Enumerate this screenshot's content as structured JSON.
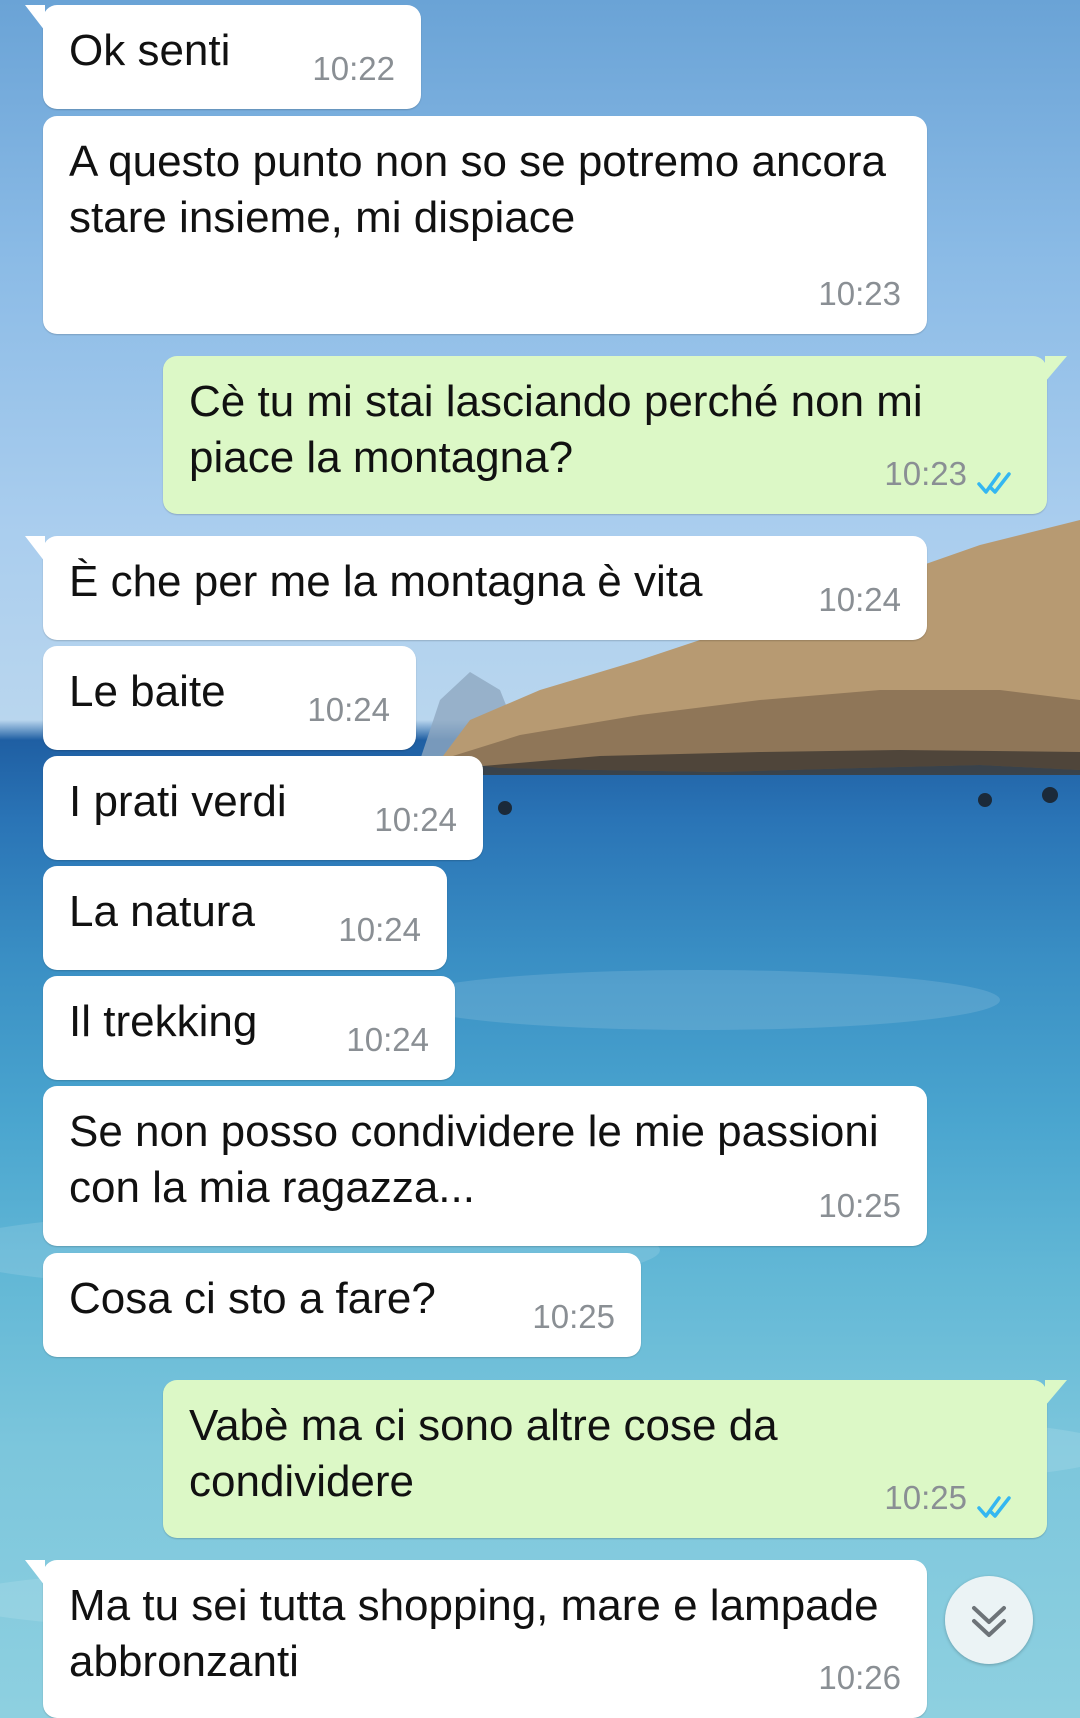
{
  "colors": {
    "incoming_bubble": "#ffffff",
    "outgoing_bubble": "#dcf8c6",
    "read_ticks": "#34b7f1",
    "timestamp": "#8a8f94"
  },
  "messages": [
    {
      "direction": "in",
      "text": "Ok senti",
      "time": "10:22"
    },
    {
      "direction": "in",
      "text": "A questo punto non so se potremo ancora stare insieme, mi dispiace",
      "time": "10:23"
    },
    {
      "direction": "out",
      "text": "Cè tu mi stai lasciando perché non mi piace la montagna?",
      "time": "10:23",
      "status": "read"
    },
    {
      "direction": "in",
      "text": "È che per me la montagna è vita",
      "time": "10:24"
    },
    {
      "direction": "in",
      "text": "Le baite",
      "time": "10:24"
    },
    {
      "direction": "in",
      "text": "I prati verdi",
      "time": "10:24"
    },
    {
      "direction": "in",
      "text": "La natura",
      "time": "10:24"
    },
    {
      "direction": "in",
      "text": "Il trekking",
      "time": "10:24"
    },
    {
      "direction": "in",
      "text": "Se non posso condividere le mie passioni con la mia ragazza...",
      "time": "10:25"
    },
    {
      "direction": "in",
      "text": "Cosa ci sto a fare?",
      "time": "10:25"
    },
    {
      "direction": "out",
      "text": "Vabè ma ci sono altre cose da condividere",
      "time": "10:25",
      "status": "read"
    },
    {
      "direction": "in",
      "text": "Ma tu sei tutta shopping, mare e lampade abbronzanti",
      "time": "10:26"
    }
  ],
  "scroll_button": {
    "icon": "double-chevron-down-icon"
  }
}
